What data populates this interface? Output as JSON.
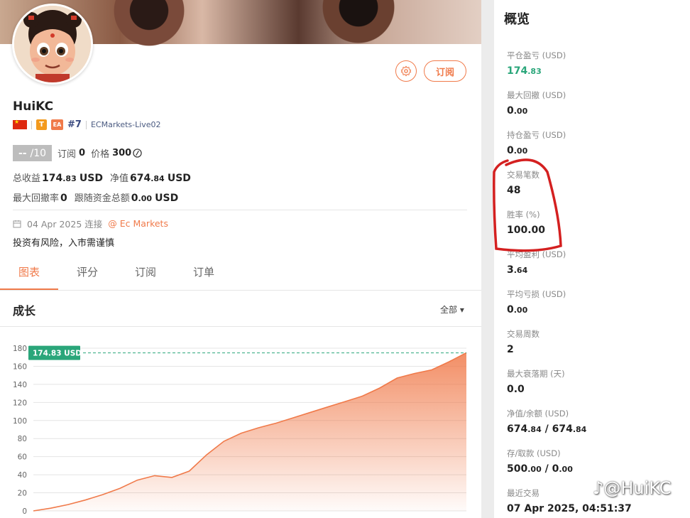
{
  "profile": {
    "username": "HuiKC",
    "rank": "#7",
    "server": "ECMarkets-Live02",
    "badge_t": "T",
    "badge_ea": "EA",
    "subscribe_label": "订阅",
    "score_main": "--",
    "score_max": "/10",
    "subs_label": "订阅",
    "subs_value": "0",
    "price_label": "价格",
    "price_value": "300",
    "total_profit_label": "总收益",
    "total_profit_int": "174",
    "total_profit_dec": ".83",
    "total_profit_unit": "USD",
    "equity_label": "净值",
    "equity_int": "674",
    "equity_dec": ".84",
    "equity_unit": "USD",
    "max_dd_label": "最大回撤率",
    "max_dd_value": "0",
    "follow_label": "跟随资金总额",
    "follow_int": "0",
    "follow_dec": ".00",
    "follow_unit": "USD",
    "joined": "04 Apr 2025 连接",
    "broker": "@ Ec Markets",
    "risk": "投资有风险，入市需谨慎"
  },
  "tabs": [
    {
      "label": "图表",
      "active": true
    },
    {
      "label": "评分",
      "active": false
    },
    {
      "label": "订阅",
      "active": false
    },
    {
      "label": "订单",
      "active": false
    }
  ],
  "growth": {
    "title": "成长",
    "range": "全部 ▾"
  },
  "chart_data": {
    "type": "area",
    "color": "#f07a4a",
    "current_label": "174.83 USD",
    "current_value": 174.83,
    "ylim": [
      0,
      180
    ],
    "yticks": [
      0,
      20,
      40,
      60,
      80,
      100,
      120,
      140,
      160,
      180
    ],
    "x": [
      0,
      1,
      2,
      3,
      4,
      5,
      6,
      7,
      8,
      9,
      10,
      11,
      12,
      13,
      14,
      15,
      16,
      17,
      18,
      19,
      20,
      21,
      22,
      23,
      24,
      25
    ],
    "values": [
      0,
      3,
      7,
      12,
      18,
      25,
      34,
      39,
      37,
      44,
      62,
      77,
      86,
      92,
      97,
      103,
      109,
      115,
      121,
      127,
      136,
      147,
      152,
      156,
      165,
      175
    ]
  },
  "overview": {
    "title": "概览",
    "stats": [
      {
        "label": "平仓盈亏 (USD)",
        "int": "174",
        "dec": ".83",
        "green": true
      },
      {
        "label": "最大回撤 (USD)",
        "int": "0",
        "dec": ".00"
      },
      {
        "label": "持仓盈亏 (USD)",
        "int": "0",
        "dec": ".00"
      },
      {
        "label": "交易笔数",
        "int": "48",
        "dec": ""
      },
      {
        "label": "胜率 (%)",
        "int": "100.00",
        "dec": ""
      },
      {
        "label": "平均盈利 (USD)",
        "int": "3",
        "dec": ".64"
      },
      {
        "label": "平均亏损 (USD)",
        "int": "0",
        "dec": ".00"
      },
      {
        "label": "交易周数",
        "int": "2",
        "dec": ""
      },
      {
        "label": "最大衰落期 (天)",
        "int": "0.0",
        "dec": ""
      },
      {
        "label": "净值/余额 (USD)",
        "int": "674",
        "dec": ".84",
        "int2": "674",
        "dec2": ".84"
      },
      {
        "label": "存/取款 (USD)",
        "int": "500",
        "dec": ".00",
        "int2": "0",
        "dec2": ".00"
      },
      {
        "label": "最近交易",
        "int": "07 Apr 2025, 04:51:37",
        "dec": ""
      }
    ]
  },
  "watermark": "@HuiKC",
  "annotation_color": "#d42020"
}
